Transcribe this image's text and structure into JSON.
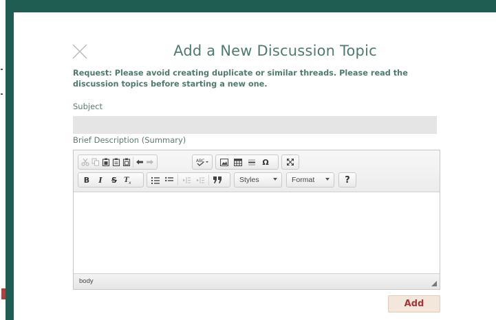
{
  "dialog": {
    "title": "Add a New Discussion Topic",
    "notice": "Request: Please avoid creating duplicate or similar threads. Please read the discussion topics before starting a new one.",
    "close_icon": "close-icon"
  },
  "form": {
    "subject_label": "Subject",
    "subject_value": "",
    "summary_label": "Brief Description (Summary)"
  },
  "editor": {
    "toolbar_row1": [
      "cut-icon",
      "copy-icon",
      "paste-icon",
      "paste-text-icon",
      "paste-word-icon",
      "undo-icon",
      "redo-icon",
      "spellcheck-icon",
      "image-icon",
      "table-icon",
      "horizontal-rule-icon",
      "special-char-icon",
      "maximize-icon"
    ],
    "toolbar_row2": [
      "bold-icon",
      "italic-icon",
      "strike-icon",
      "remove-format-icon",
      "numbered-list-icon",
      "bulleted-list-icon",
      "outdent-icon",
      "indent-icon",
      "blockquote-icon"
    ],
    "bold_glyph": "B",
    "italic_glyph": "I",
    "strike_glyph": "S",
    "special_char_glyph": "Ω",
    "styles_combo": "Styles",
    "format_combo": "Format",
    "help_glyph": "?",
    "status_path": "body"
  },
  "actions": {
    "add_label": "Add"
  },
  "colors": {
    "frame": "#1f5c51",
    "title": "#4f7a70",
    "add_text": "#a83434",
    "add_bg": "#f3e6db"
  }
}
